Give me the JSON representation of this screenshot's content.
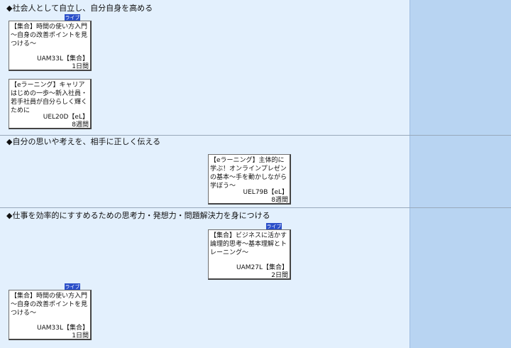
{
  "sections": [
    {
      "title": "◆社会人として自立し、自分自身を高める",
      "cards": [
        {
          "badge": "ライブ",
          "title": "【集合】時間の使い方入門～自身の改善ポイントを見つける～",
          "code": "UAM33L【集合】",
          "duration": "1日間"
        },
        {
          "title": "【eラーニング】キャリアはじめの一歩～新入社員・若手社員が自分らしく輝くために",
          "code": "UEL20D【eL】",
          "duration": "8週間"
        }
      ]
    },
    {
      "title": "◆自分の思いや考えを、相手に正しく伝える",
      "cards": [
        {
          "title": "【eラーニング】主体的に学ぶ！オンラインプレゼンの基本～手を動かしながら学ぼう～",
          "code": "UEL79B【eL】",
          "duration": "8週間"
        }
      ]
    },
    {
      "title": "◆仕事を効率的にすすめるための思考力・発想力・問題解決力を身につける",
      "cards": [
        {
          "badge": "ライブ",
          "title": "【集合】ビジネスに活かす論理的思考～基本理解とトレーニング～",
          "code": "UAM27L【集合】",
          "duration": "2日間"
        },
        {
          "badge": "ライブ",
          "title": "【集合】時間の使い方入門～自身の改善ポイントを見つける～",
          "code": "UAM33L【集合】",
          "duration": "1日間"
        }
      ]
    }
  ]
}
